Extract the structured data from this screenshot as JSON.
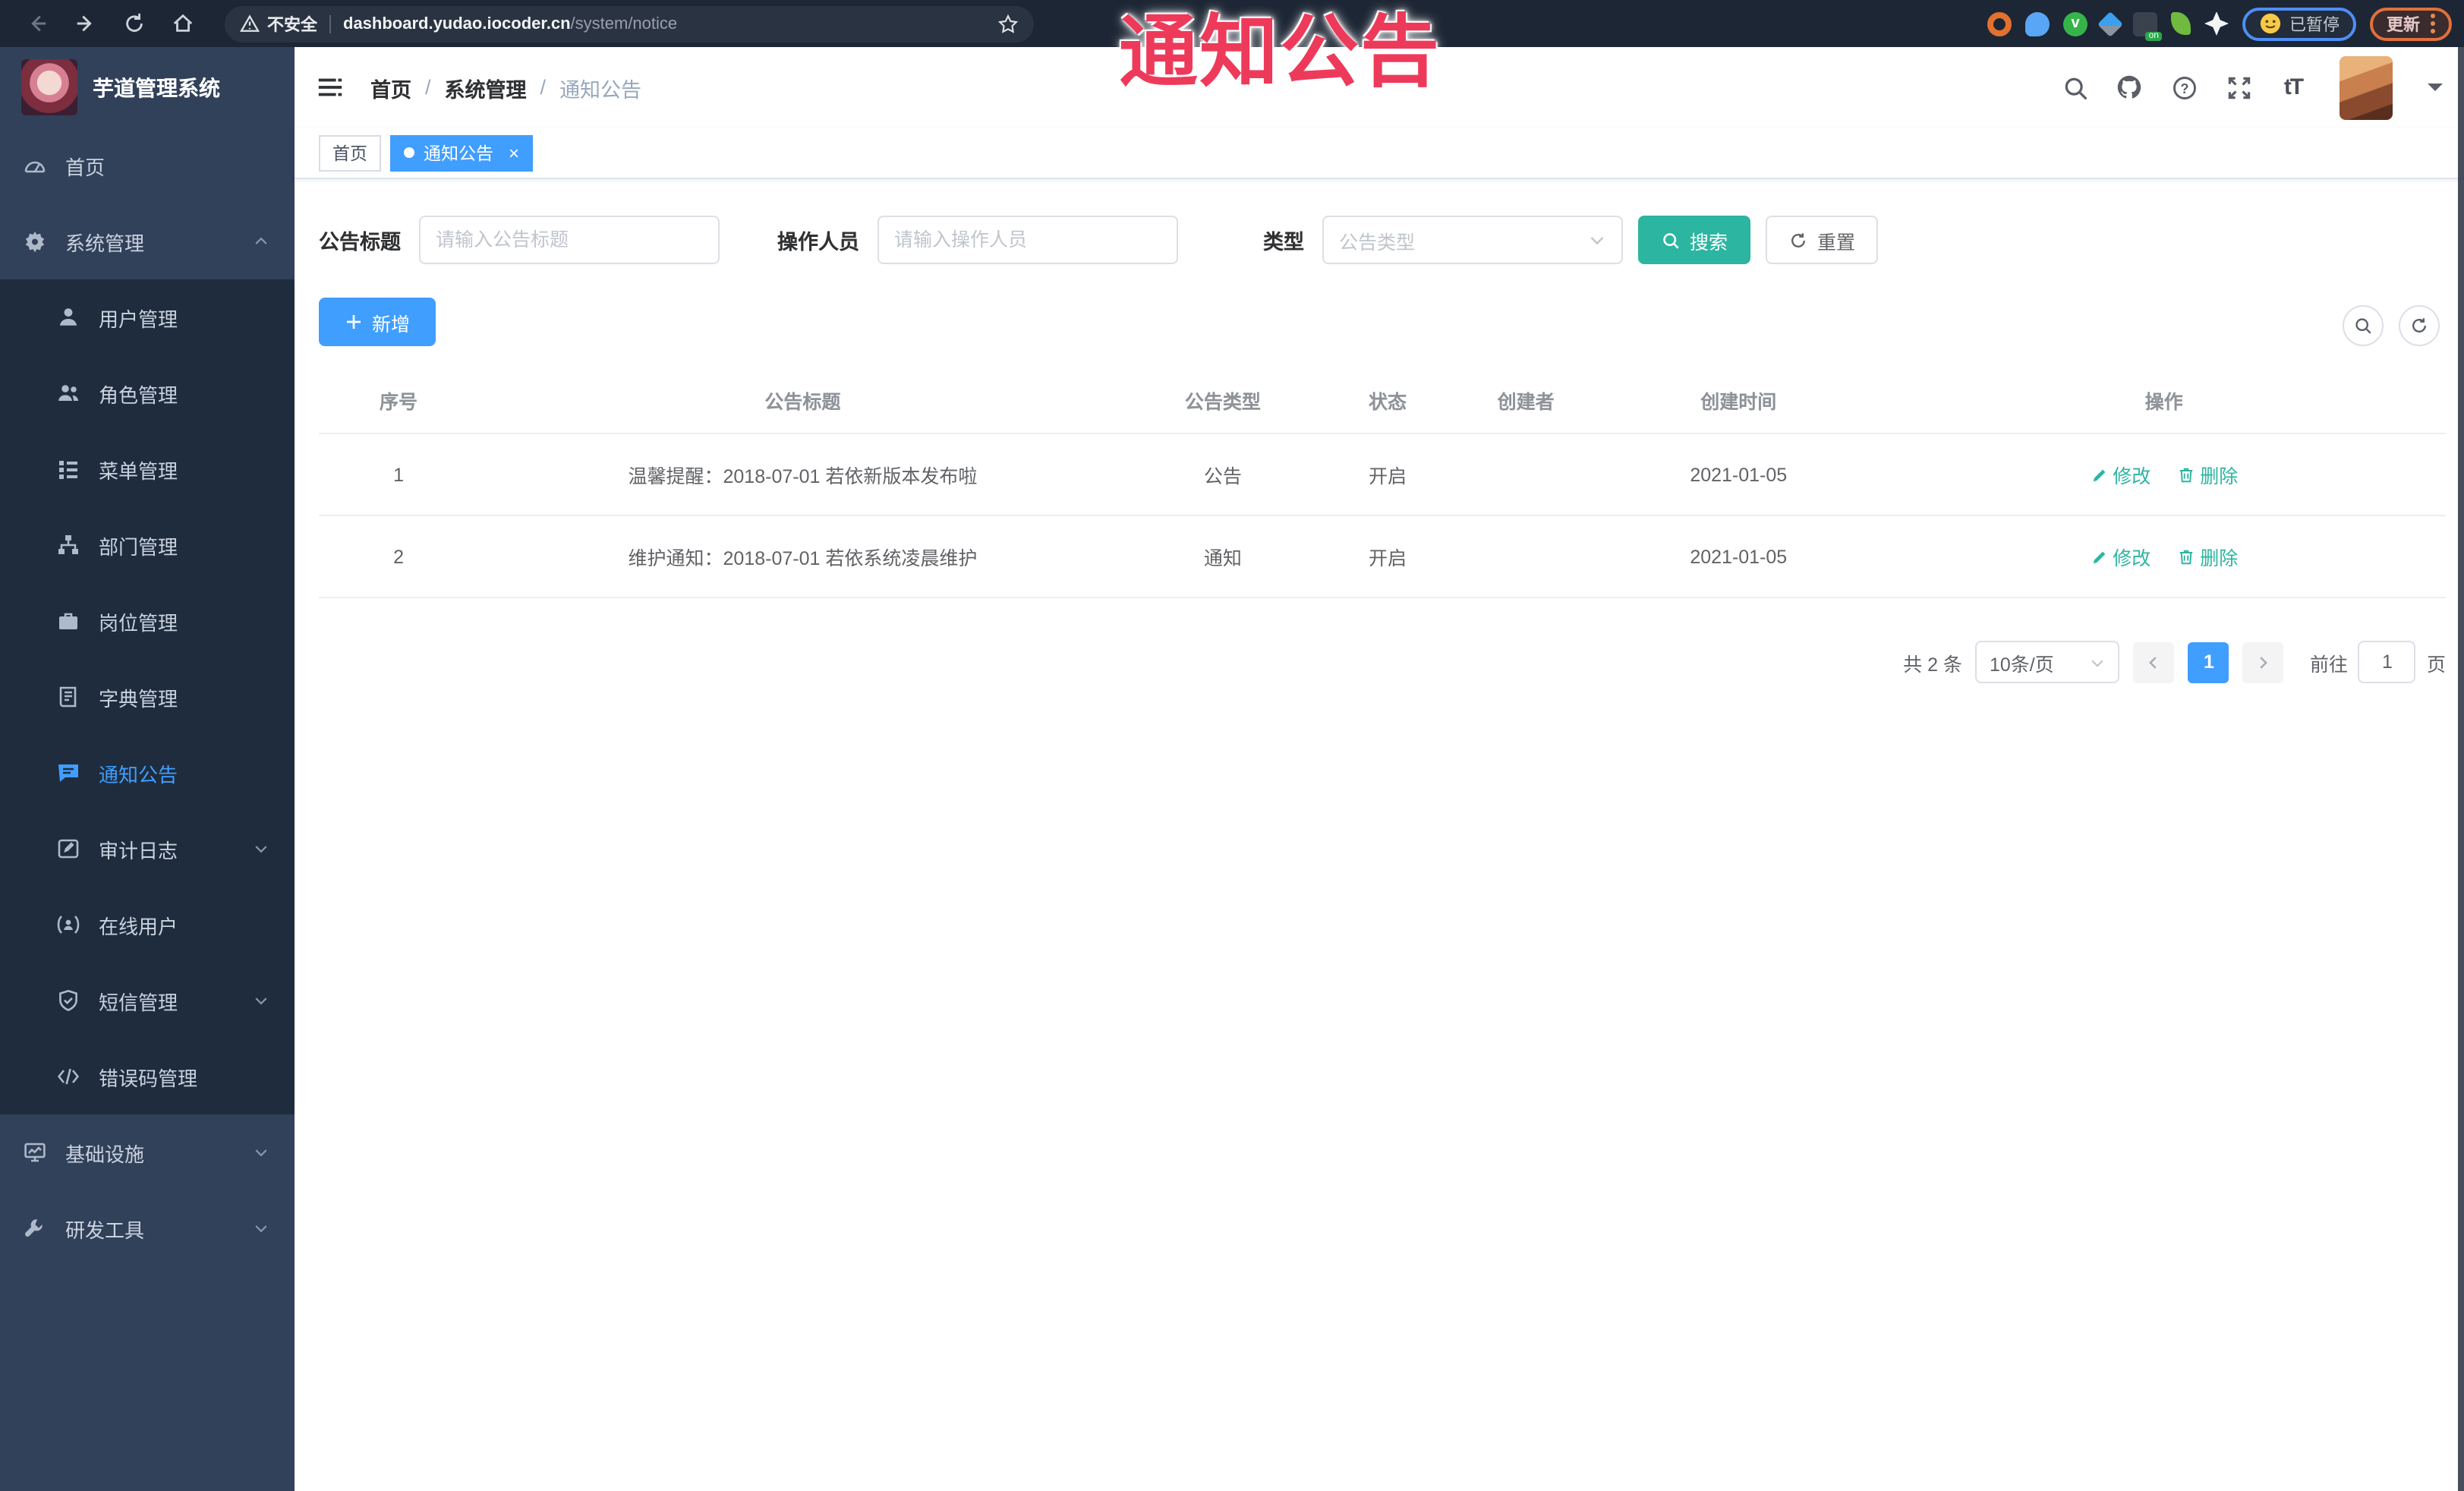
{
  "browser": {
    "security_label": "不安全",
    "url_host": "dashboard.yudao.iocoder.cn",
    "url_path": "/system/notice",
    "paused_label": "已暂停",
    "update_label": "更新",
    "extensions": [
      "extension-orange-icon",
      "extension-drop-icon",
      "extension-green-icon",
      "extension-diamond-icon",
      "extension-dark-on-icon",
      "extension-leaf-icon",
      "extension-flower-icon"
    ]
  },
  "overlay": {
    "title": "通知公告"
  },
  "sidebar": {
    "app_title": "芋道管理系统",
    "items": [
      {
        "label": "首页",
        "icon": "dashboard-icon",
        "level": "root",
        "active": false,
        "arrow": ""
      },
      {
        "label": "系统管理",
        "icon": "gear-icon",
        "level": "root",
        "active": false,
        "arrow": "up"
      },
      {
        "label": "用户管理",
        "icon": "user-icon",
        "level": "sub",
        "active": false,
        "arrow": ""
      },
      {
        "label": "角色管理",
        "icon": "users-icon",
        "level": "sub",
        "active": false,
        "arrow": ""
      },
      {
        "label": "菜单管理",
        "icon": "menu-tree-icon",
        "level": "sub",
        "active": false,
        "arrow": ""
      },
      {
        "label": "部门管理",
        "icon": "org-icon",
        "level": "sub",
        "active": false,
        "arrow": ""
      },
      {
        "label": "岗位管理",
        "icon": "badge-icon",
        "level": "sub",
        "active": false,
        "arrow": ""
      },
      {
        "label": "字典管理",
        "icon": "dictionary-icon",
        "level": "sub",
        "active": false,
        "arrow": ""
      },
      {
        "label": "通知公告",
        "icon": "announcement-icon",
        "level": "sub",
        "active": true,
        "arrow": ""
      },
      {
        "label": "审计日志",
        "icon": "audit-log-icon",
        "level": "sub",
        "active": false,
        "arrow": "down"
      },
      {
        "label": "在线用户",
        "icon": "online-user-icon",
        "level": "sub",
        "active": false,
        "arrow": ""
      },
      {
        "label": "短信管理",
        "icon": "sms-icon",
        "level": "sub",
        "active": false,
        "arrow": "down"
      },
      {
        "label": "错误码管理",
        "icon": "error-code-icon",
        "level": "sub",
        "active": false,
        "arrow": ""
      },
      {
        "label": "基础设施",
        "icon": "infrastructure-icon",
        "level": "root",
        "active": false,
        "arrow": "down"
      },
      {
        "label": "研发工具",
        "icon": "dev-tools-icon",
        "level": "root",
        "active": false,
        "arrow": "down"
      }
    ]
  },
  "breadcrumb": {
    "items": [
      "首页",
      "系统管理",
      "通知公告"
    ]
  },
  "tags": [
    {
      "label": "首页",
      "active": false,
      "closable": false
    },
    {
      "label": "通知公告",
      "active": true,
      "closable": true
    }
  ],
  "filters": {
    "title_label": "公告标题",
    "title_placeholder": "请输入公告标题",
    "operator_label": "操作人员",
    "operator_placeholder": "请输入操作人员",
    "type_label": "类型",
    "type_placeholder": "公告类型",
    "search_label": "搜索",
    "reset_label": "重置"
  },
  "toolbar": {
    "add_label": "新增"
  },
  "table": {
    "headers": [
      "序号",
      "公告标题",
      "公告类型",
      "状态",
      "创建者",
      "创建时间",
      "操作"
    ],
    "col_widths": [
      "7.5%",
      "30.5%",
      "9%",
      "6.5%",
      "6.5%",
      "13.5%",
      "26.5%"
    ],
    "rows": [
      {
        "no": "1",
        "title": "温馨提醒：2018-07-01 若依新版本发布啦",
        "type": "公告",
        "status": "开启",
        "creator": "",
        "time": "2021-01-05"
      },
      {
        "no": "2",
        "title": "维护通知：2018-07-01 若依系统凌晨维护",
        "type": "通知",
        "status": "开启",
        "creator": "",
        "time": "2021-01-05"
      }
    ],
    "edit_label": "修改",
    "delete_label": "删除"
  },
  "pagination": {
    "total_text": "共 2 条",
    "page_size": "10条/页",
    "current_page": "1",
    "goto_label": "前往",
    "goto_value": "1",
    "page_unit": "页"
  },
  "colors": {
    "accent": "#409eff",
    "teal": "#2cb5a1",
    "sidebar": "#32415a",
    "submenu": "#1f2c3d",
    "annotation": "#ee3a5a"
  }
}
